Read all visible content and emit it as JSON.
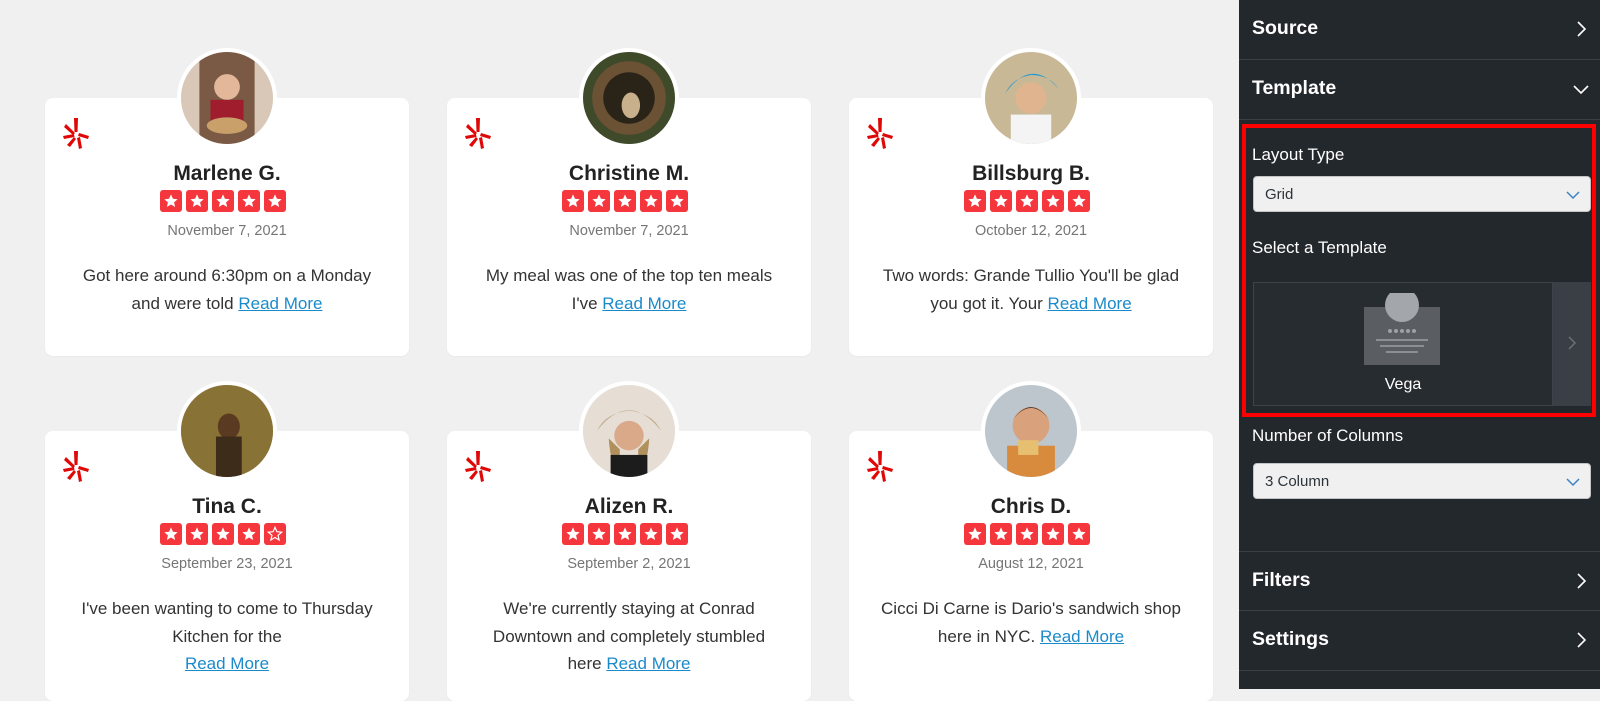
{
  "reviews": [
    {
      "name": "Marlene G.",
      "rating": 5,
      "date": "November 7, 2021",
      "text": "Got here around 6:30pm on a Monday and were told",
      "read_more": "Read More"
    },
    {
      "name": "Christine M.",
      "rating": 5,
      "date": "November 7, 2021",
      "text": "My meal was one of the top ten meals I've",
      "read_more": "Read More"
    },
    {
      "name": "Billsburg B.",
      "rating": 5,
      "date": "October 12, 2021",
      "text": "Two words: Grande Tullio You'll be glad you got it. Your",
      "read_more": "Read More"
    },
    {
      "name": "Tina C.",
      "rating": 4,
      "date": "September 23, 2021",
      "text": "I've been wanting to come to Thursday Kitchen for the",
      "read_more": "Read More"
    },
    {
      "name": "Alizen R.",
      "rating": 5,
      "date": "September 2, 2021",
      "text": "We're currently staying at Conrad Downtown and completely stumbled here",
      "read_more": "Read More"
    },
    {
      "name": "Chris D.",
      "rating": 5,
      "date": "August 12, 2021",
      "text": "Cicci Di Carne is Dario's sandwich shop here in NYC.",
      "read_more": "Read More"
    }
  ],
  "panel": {
    "source": {
      "title": "Source"
    },
    "template": {
      "title": "Template",
      "layout_type_label": "Layout Type",
      "layout_type_value": "Grid",
      "select_template_label": "Select a Template",
      "template_name": "Vega",
      "columns_label": "Number of Columns",
      "columns_value": "3 Column"
    },
    "filters": {
      "title": "Filters"
    },
    "settings": {
      "title": "Settings"
    }
  },
  "colors": {
    "yelp_red": "#f5363c",
    "link": "#1a8acb",
    "panel_bg": "#23282d",
    "highlight": "#ff0000"
  }
}
